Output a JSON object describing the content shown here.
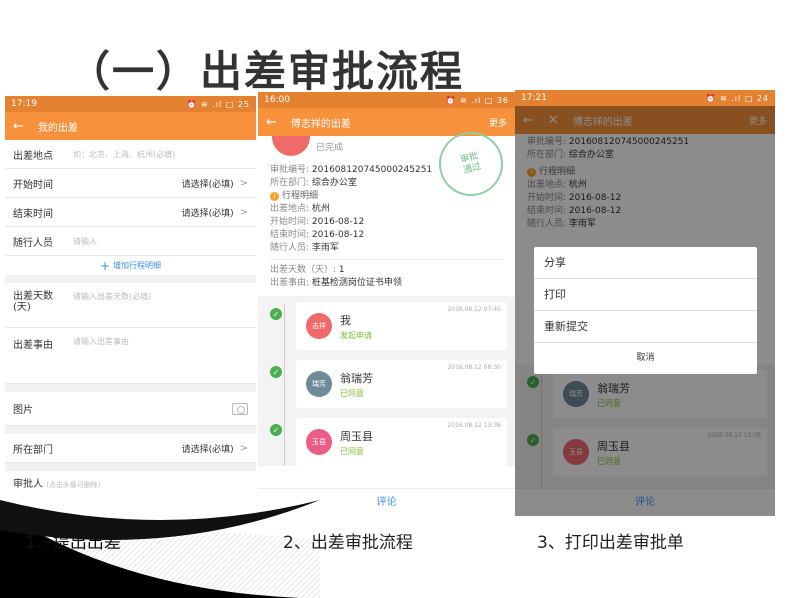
{
  "slide": {
    "title": "（一）出差审批流程"
  },
  "phone1": {
    "status": {
      "time": "17:19",
      "icons": "⏰ ≋ .ıl □ 25"
    },
    "appbar": {
      "back": "←",
      "title": "我的出差"
    },
    "rows": [
      {
        "label": "出差地点",
        "placeholder": "如：北京、上海、杭州(必填)"
      },
      {
        "label": "开始时间",
        "value": "请选择(必填)",
        "chevron": ">"
      },
      {
        "label": "结束时间",
        "value": "请选择(必填)",
        "chevron": ">"
      },
      {
        "label": "随行人员",
        "placeholder": "请输入"
      }
    ],
    "add_link": "增加行程明细",
    "add_plus": "+",
    "days": {
      "label": "出差天数\n(天)",
      "placeholder": "请输入出差天数(必填)"
    },
    "reason": {
      "label": "出差事由",
      "placeholder": "请输入出差事由"
    },
    "image_label": "图片",
    "dept": {
      "label": "所在部门",
      "value": "请选择(必填)",
      "chevron": ">"
    },
    "approver": {
      "label": "审批人",
      "hint": "(点击头像可删除)"
    }
  },
  "phone2": {
    "status": {
      "time": "16:00",
      "icons": "⏰ ≋ .ıl □ 36"
    },
    "appbar": {
      "back": "←",
      "title": "傅志祥的出差",
      "more": "更多"
    },
    "done_text": "已完成",
    "stamp": "审批\n通过",
    "approval_no": {
      "k": "审批编号: ",
      "v": "20160812074500024525​1"
    },
    "dept": {
      "k": "所在部门: ",
      "v": "综合办公室"
    },
    "section": "行程明细",
    "section_icon": "!",
    "trip": [
      {
        "k": "出差地点: ",
        "v": "杭州"
      },
      {
        "k": "开始时间: ",
        "v": "2016-08-12"
      },
      {
        "k": "结束时间: ",
        "v": "2016-08-12"
      },
      {
        "k": "随行人员: ",
        "v": "李雨军"
      }
    ],
    "days": {
      "k": "出差天数（天）: ",
      "v": "1"
    },
    "reason": {
      "k": "出差事由: ",
      "v": "桩基检测岗位证书申领"
    },
    "timeline": [
      {
        "avatar": "志祥",
        "name": "我",
        "status": "发起申请",
        "date": "2016.08.12 07:45"
      },
      {
        "avatar": "瑞芳",
        "name": "翁瑞芳",
        "status": "已同意",
        "date": "2016.08.12 08:30"
      },
      {
        "avatar": "玉县",
        "name": "周玉县",
        "status": "已同意",
        "date": "2016.08.12 13:36"
      }
    ],
    "check": "✓",
    "comment": "评论"
  },
  "phone3": {
    "status": {
      "time": "17:21",
      "icons": "⏰ ≋ .ıl □ 24"
    },
    "appbar": {
      "back": "←",
      "close": "✕",
      "title": "傅志祥的出差",
      "more": "更多"
    },
    "approval_no": {
      "k": "审批编号: ",
      "v": "20160812074500024525​1"
    },
    "dept": {
      "k": "所在部门: ",
      "v": "综合办公室"
    },
    "section": "行程明细",
    "section_icon": "!",
    "trip": [
      {
        "k": "出差地点: ",
        "v": "杭州"
      },
      {
        "k": "开始时间: ",
        "v": "2016-08-12"
      },
      {
        "k": "结束时间: ",
        "v": "2016-08-12"
      },
      {
        "k": "随行人员: ",
        "v": "李雨军"
      }
    ],
    "dialog": {
      "options": [
        "分享",
        "打印",
        "重新提交"
      ],
      "cancel": "取消"
    },
    "timeline": [
      {
        "avatar": "瑞芳",
        "name": "翁瑞芳",
        "status": "已同意",
        "date": ""
      },
      {
        "avatar": "玉县",
        "name": "周玉县",
        "status": "已同意",
        "date": "2016.08.12 13:36"
      }
    ],
    "check": "✓",
    "comment": "评论"
  },
  "captions": [
    "1、提出出差",
    "2、出差审批流程",
    "3、打印出差审批单"
  ],
  "colors": {
    "accent": "#f7913c",
    "link": "#3d8ff0",
    "approved": "#7bbf2c"
  }
}
